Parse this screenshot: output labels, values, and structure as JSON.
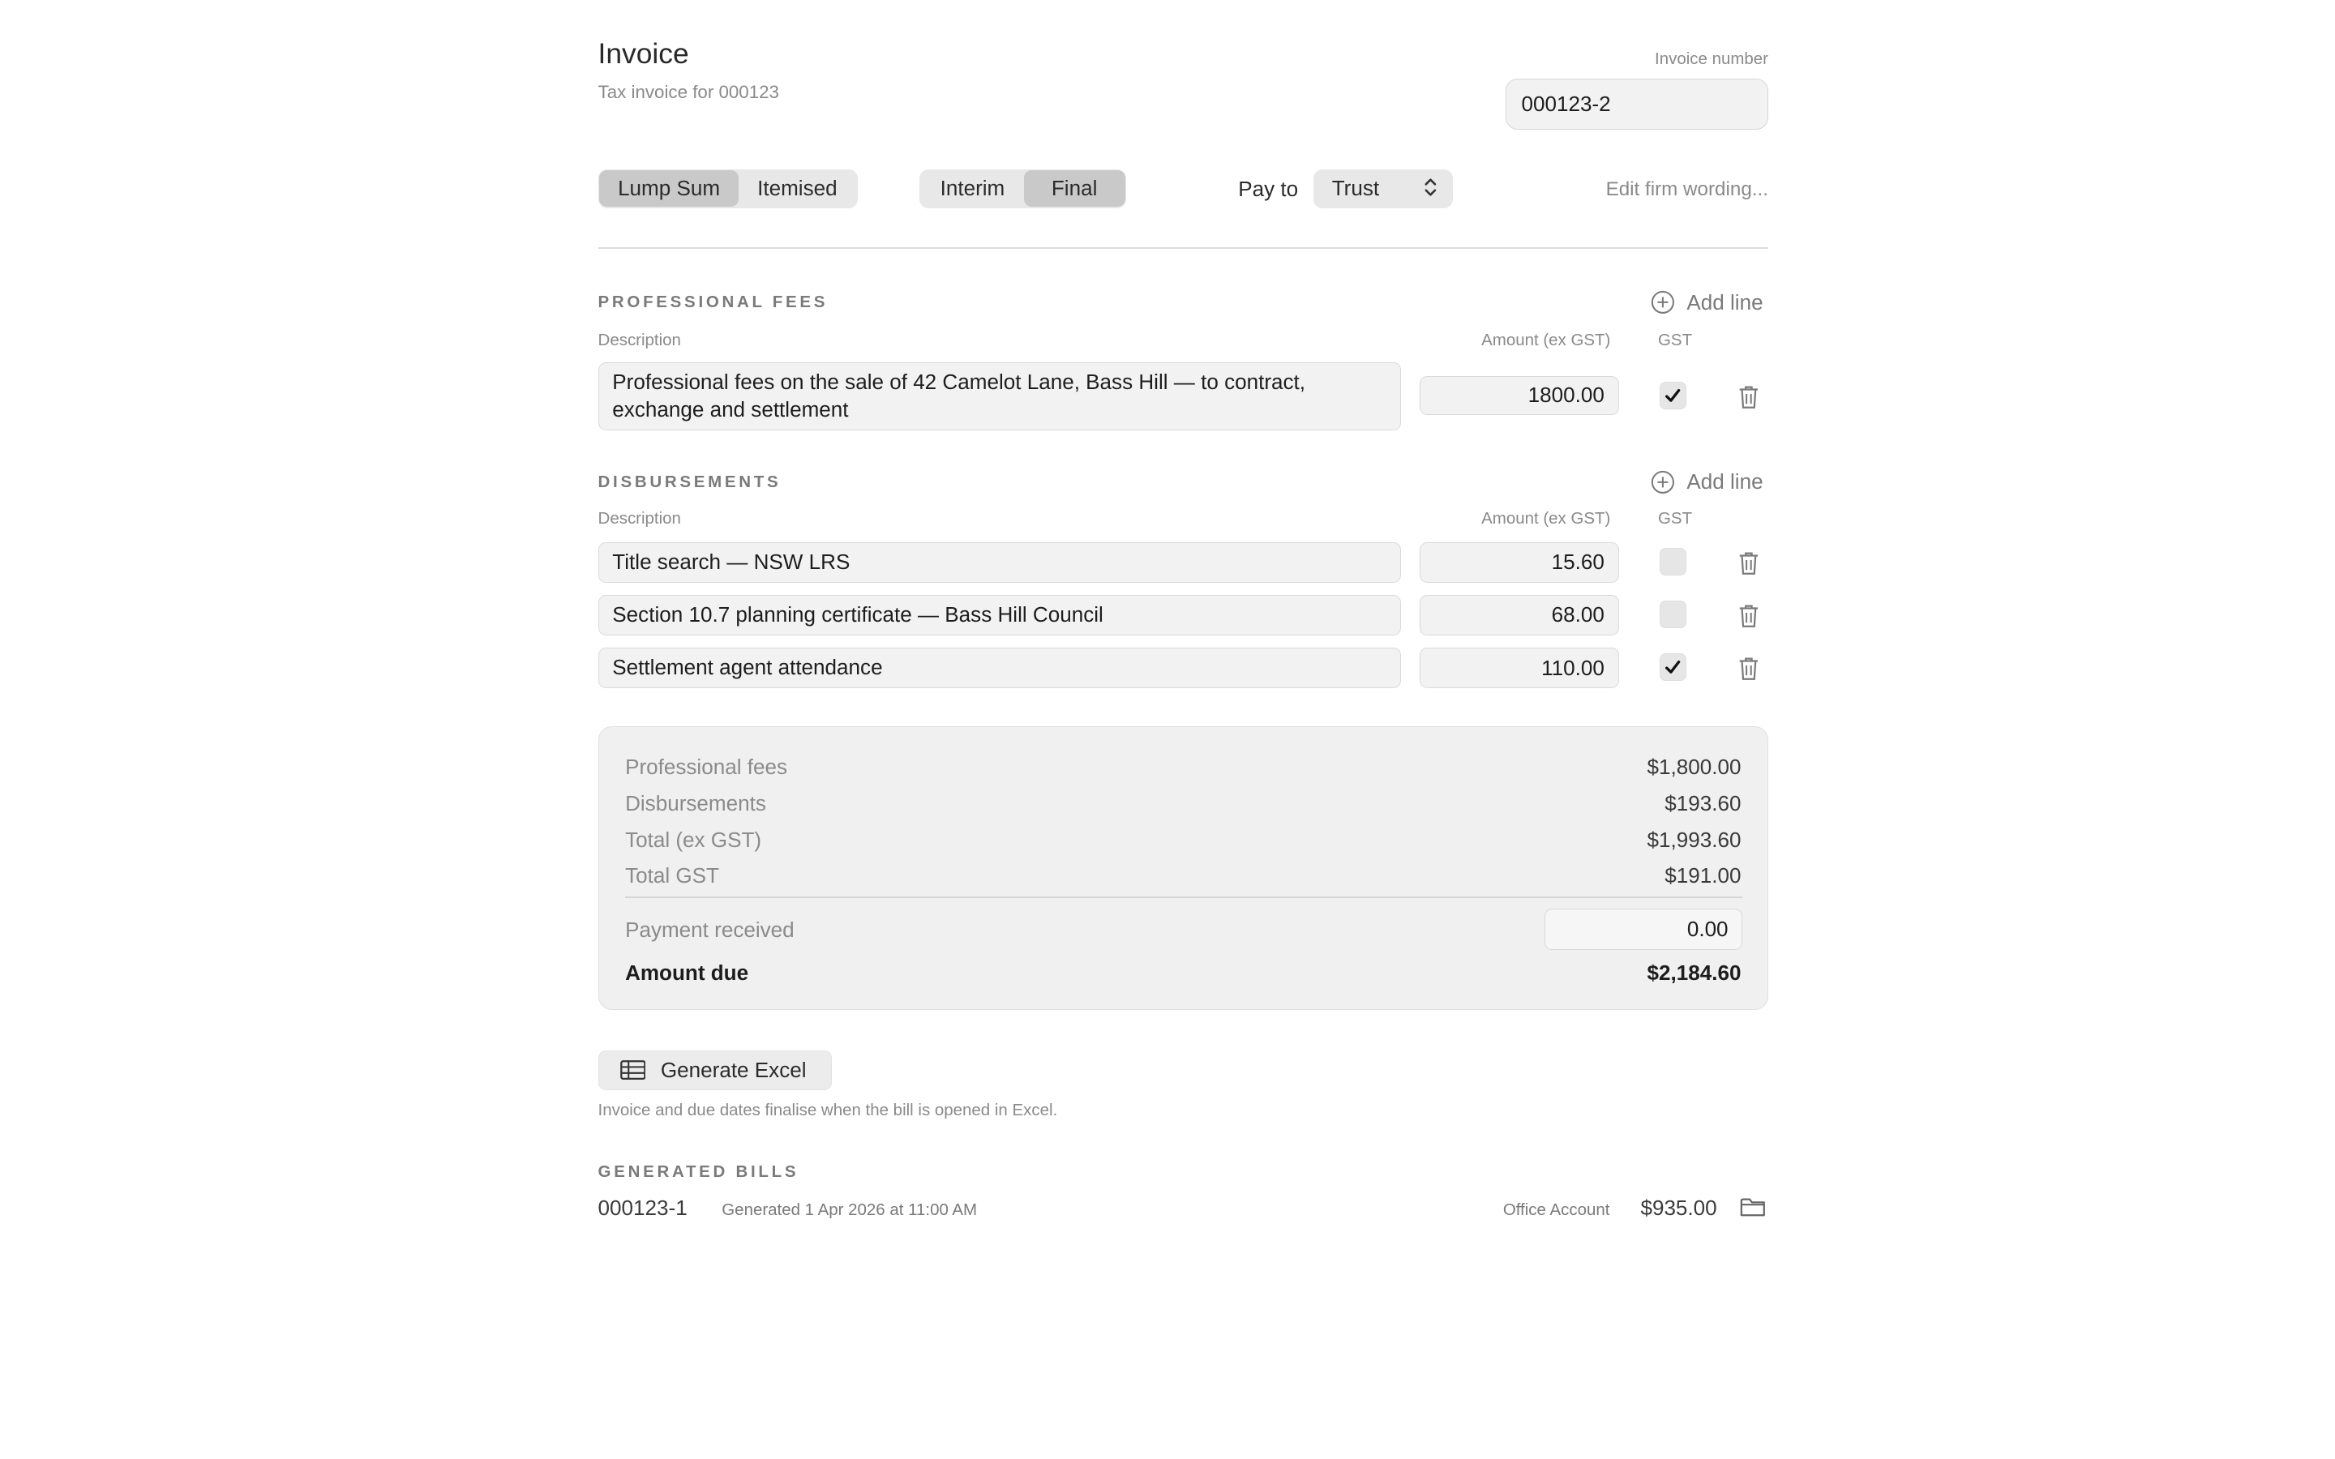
{
  "header": {
    "title": "Invoice",
    "subtitle": "Tax invoice for 000123",
    "invoice_number_label": "Invoice number",
    "invoice_number_value": "000123-2"
  },
  "controls": {
    "billing_type": {
      "options": [
        "Lump Sum",
        "Itemised"
      ],
      "selected": "Lump Sum"
    },
    "invoice_stage": {
      "options": [
        "Interim",
        "Final"
      ],
      "selected": "Final"
    },
    "pay_to_label": "Pay to",
    "pay_to_value": "Trust",
    "edit_wording_label": "Edit firm wording..."
  },
  "professional_fees": {
    "title": "PROFESSIONAL FEES",
    "add_line_label": "Add line",
    "col_description": "Description",
    "col_amount": "Amount (ex GST)",
    "col_gst": "GST",
    "rows": [
      {
        "description": "Professional fees on the sale of 42 Camelot Lane, Bass Hill — to contract, exchange and settlement",
        "amount": "1800.00",
        "gst": true
      }
    ]
  },
  "disbursements": {
    "title": "DISBURSEMENTS",
    "add_line_label": "Add line",
    "col_description": "Description",
    "col_amount": "Amount (ex GST)",
    "col_gst": "GST",
    "rows": [
      {
        "description": "Title search — NSW LRS",
        "amount": "15.60",
        "gst": false
      },
      {
        "description": "Section 10.7 planning certificate — Bass Hill Council",
        "amount": "68.00",
        "gst": false
      },
      {
        "description": "Settlement agent attendance",
        "amount": "110.00",
        "gst": true
      }
    ]
  },
  "totals": {
    "professional_fees_label": "Professional fees",
    "professional_fees_value": "$1,800.00",
    "disbursements_label": "Disbursements",
    "disbursements_value": "$193.60",
    "total_ex_gst_label": "Total (ex GST)",
    "total_ex_gst_value": "$1,993.60",
    "total_gst_label": "Total GST",
    "total_gst_value": "$191.00",
    "payment_received_label": "Payment received",
    "payment_received_value": "0.00",
    "amount_due_label": "Amount due",
    "amount_due_value": "$2,184.60"
  },
  "generate": {
    "button_label": "Generate Excel",
    "note": "Invoice and due dates finalise when the bill is opened in Excel."
  },
  "generated_bills": {
    "title": "GENERATED BILLS",
    "items": [
      {
        "id": "000123-1",
        "generated": "Generated 1 Apr 2026 at 11:00 AM",
        "account": "Office Account",
        "amount": "$935.00"
      }
    ]
  },
  "colors": {
    "field_bg": "#f2f2f2",
    "selected_segment": "#c9c9c9",
    "muted_text": "#8a8a8a"
  }
}
